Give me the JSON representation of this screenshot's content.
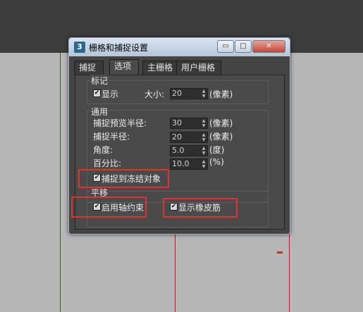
{
  "dialog": {
    "icon_text": "3",
    "title": "栅格和捕捉设置",
    "buttons": [
      "▭",
      "□",
      "✕"
    ]
  },
  "tabs": [
    "捕捉",
    "选项",
    "主栅格",
    "用户栅格"
  ],
  "markers": {
    "group_label": "标记",
    "display_label": "显示",
    "display_checked": true,
    "size_label": "大小:",
    "size_value": "20",
    "size_unit": "(像素)"
  },
  "general": {
    "group_label": "通用",
    "rows": [
      {
        "label": "捕捉预览半径:",
        "value": "30",
        "unit": "(像素)"
      },
      {
        "label": "捕捉半径:",
        "value": "20",
        "unit": "(像素)"
      },
      {
        "label": "角度:",
        "value": "5.0",
        "unit": "(度)"
      },
      {
        "label": "百分比:",
        "value": "10.0",
        "unit": "(%)"
      }
    ],
    "snap_frozen_label": "捕捉到冻结对象",
    "snap_frozen_checked": true
  },
  "translation": {
    "group_label": "平移",
    "axis_constraint_label": "启用轴约束",
    "axis_constraint_checked": true,
    "rubber_band_label": "显示橡皮筋",
    "rubber_band_checked": true
  },
  "checkmark": "✔"
}
